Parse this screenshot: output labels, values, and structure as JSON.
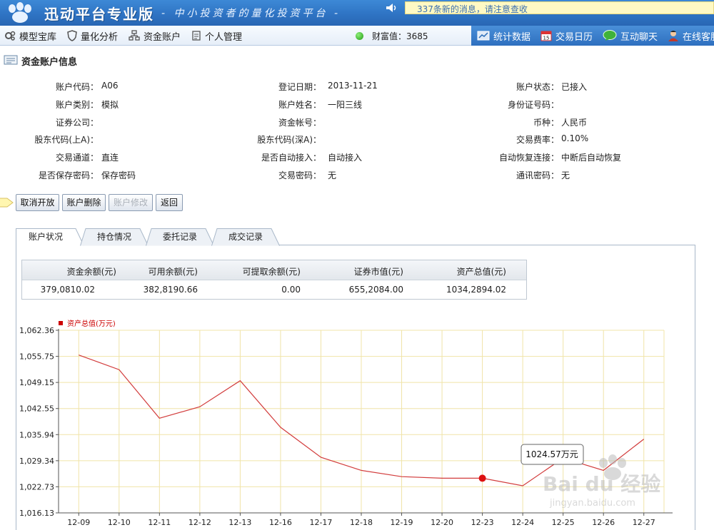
{
  "header": {
    "app_title": "迅动平台专业版",
    "slogan": "- 中小投资者的量化投资平台 -",
    "news": "337条新的消息，请注意查收"
  },
  "menu": {
    "left": [
      {
        "label": "模型宝库",
        "icon": "gear-icon"
      },
      {
        "label": "量化分析",
        "icon": "shield-icon"
      },
      {
        "label": "资金账户",
        "icon": "org-chart-icon"
      },
      {
        "label": "个人管理",
        "icon": "document-icon"
      }
    ],
    "wealth_label": "财富值：3685",
    "right": [
      {
        "label": "统计数据",
        "icon": "stats-icon"
      },
      {
        "label": "交易日历",
        "icon": "calendar-icon"
      },
      {
        "label": "互动聊天",
        "icon": "chat-icon"
      },
      {
        "label": "在线客服",
        "icon": "person-icon"
      }
    ]
  },
  "section_title": "资金账户信息",
  "info": {
    "rows": [
      [
        [
          "账户代码：",
          "A06"
        ],
        [
          "登记日期：",
          "2013-11-21"
        ],
        [
          "账户状态：",
          "已接入"
        ]
      ],
      [
        [
          "账户类别：",
          "模拟"
        ],
        [
          "账户姓名：",
          "一阳三线"
        ],
        [
          "身份证号码：",
          ""
        ]
      ],
      [
        [
          "证券公司：",
          ""
        ],
        [
          "资金帐号：",
          ""
        ],
        [
          "币种：",
          "人民币"
        ]
      ],
      [
        [
          "股东代码(上A)：",
          ""
        ],
        [
          "股东代码(深A)：",
          ""
        ],
        [
          "交易费率：",
          "0.10%"
        ]
      ],
      [
        [
          "交易通道：",
          "直连"
        ],
        [
          "是否自动接入：",
          "自动接入"
        ],
        [
          "自动恢复连接：",
          "中断后自动恢复"
        ]
      ],
      [
        [
          "是否保存密码：",
          "保存密码"
        ],
        [
          "交易密码：",
          "无"
        ],
        [
          "通讯密码：",
          "无"
        ]
      ]
    ]
  },
  "buttons": {
    "cancel_open": "取消开放",
    "delete_account": "账户删除",
    "modify_account": "账户修改",
    "back": "返回"
  },
  "tabs": [
    "账户状况",
    "持仓情况",
    "委托记录",
    "成交记录"
  ],
  "summary": {
    "headers": [
      "资金余额(元)",
      "可用余额(元)",
      "可提取余额(元)",
      "证券市值(元)",
      "资产总值(元)"
    ],
    "values": [
      "379,0810.02",
      "382,8190.66",
      "0.00",
      "655,2084.00",
      "1034,2894.02"
    ]
  },
  "chart_data": {
    "type": "line",
    "legend": "资产总值(万元)",
    "legend_color": "#cc0000",
    "line_color": "#d23c3c",
    "grid_color": "#f0e4a8",
    "categories": [
      "12-09",
      "12-10",
      "12-11",
      "12-12",
      "12-13",
      "12-16",
      "12-17",
      "12-18",
      "12-19",
      "12-20",
      "12-23",
      "12-24",
      "12-25",
      "12-26",
      "12-27"
    ],
    "values": [
      1056.1,
      1052.4,
      1040.1,
      1043.0,
      1049.6,
      1037.8,
      1030.2,
      1026.9,
      1025.3,
      1024.9,
      1024.9,
      1023.0,
      1030.0,
      1026.9,
      1034.8
    ],
    "y_ticks": [
      "1,062.36",
      "1,055.75",
      "1,049.15",
      "1,042.55",
      "1,035.94",
      "1,029.34",
      "1,022.73",
      "1,016.13"
    ],
    "ylim": [
      1016.13,
      1062.36
    ],
    "highlight_index": 10,
    "tooltip": "1024.57万元"
  },
  "watermark": {
    "brand": "Bai du 经验",
    "url": "jingyan.baidu.com"
  }
}
